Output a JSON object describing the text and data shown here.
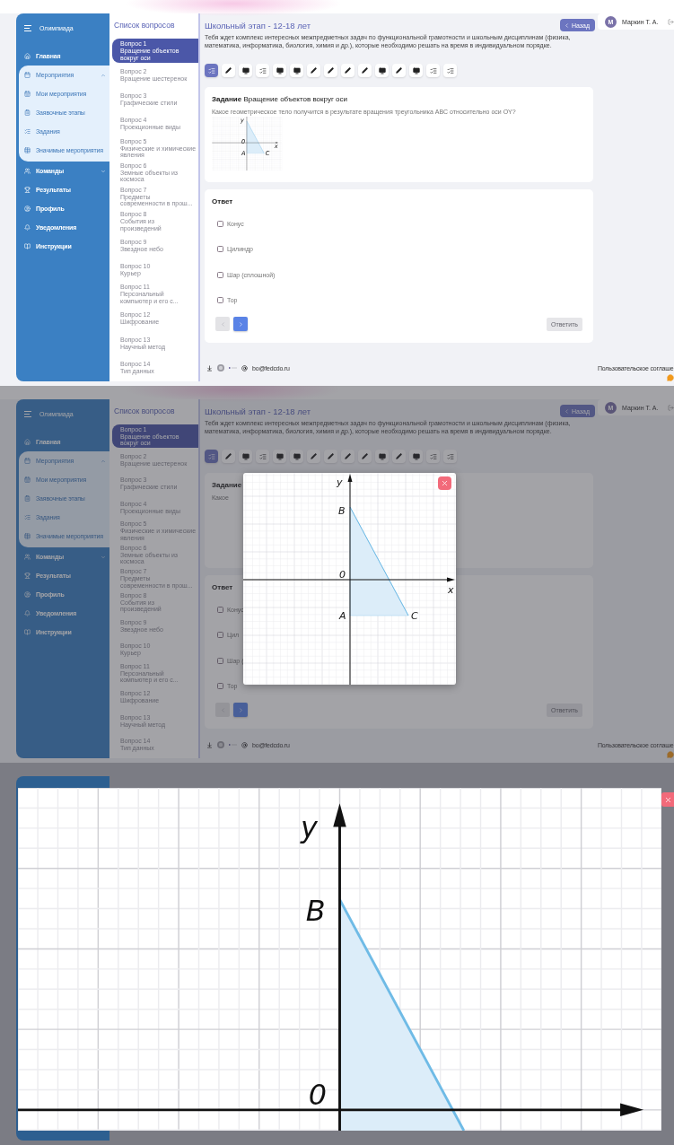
{
  "screens": [
    {
      "kind": "plain",
      "app": {
        "brand": "Олимпиада",
        "nav": [
          {
            "label": "Главная"
          },
          {
            "label": "Мероприятия",
            "expanded": true,
            "children": [
              {
                "label": "Мои мероприятия"
              },
              {
                "label": "Заявочные этапы"
              },
              {
                "label": "Задания"
              },
              {
                "label": "Значимые мероприятия"
              }
            ]
          },
          {
            "label": "Команды",
            "expanded": false
          },
          {
            "label": "Результаты"
          },
          {
            "label": "Профиль"
          },
          {
            "label": "Уведомления"
          },
          {
            "label": "Инструкции"
          }
        ],
        "questions_title": "Список вопросов",
        "questions": [
          {
            "title": "Вопрос 1",
            "subtitle": "Вращение объектов вокруг оси",
            "selected": true
          },
          {
            "title": "Вопрос 2",
            "subtitle": "Вращение шестеренок",
            "selected": false
          },
          {
            "title": "Вопрос 3",
            "subtitle": "Графические стили",
            "selected": false
          },
          {
            "title": "Вопрос 4",
            "subtitle": "Проекционные виды",
            "selected": false
          },
          {
            "title": "Вопрос 5",
            "subtitle": "Физические и химические явления",
            "selected": false
          },
          {
            "title": "Вопрос 6",
            "subtitle": "Земные объекты из космоса",
            "selected": false
          },
          {
            "title": "Вопрос 7",
            "subtitle": "Предметы современности в прош...",
            "selected": false
          },
          {
            "title": "Вопрос 8",
            "subtitle": "События из произведений",
            "selected": false
          },
          {
            "title": "Вопрос 9",
            "subtitle": "Звездное небо",
            "selected": false
          },
          {
            "title": "Вопрос 10",
            "subtitle": "Курьер",
            "selected": false
          },
          {
            "title": "Вопрос 11",
            "subtitle": "Персональный компьютер и его с...",
            "selected": false
          },
          {
            "title": "Вопрос 12",
            "subtitle": "Шифрование",
            "selected": false
          },
          {
            "title": "Вопрос 13",
            "subtitle": "Научный метод",
            "selected": false
          },
          {
            "title": "Вопрос 14",
            "subtitle": "Тип данных",
            "selected": false
          }
        ],
        "stage_title": "Школьный этап - 12-18 лет",
        "description": "Тебя ждет комплекс интересных межпредметных задач по функциональной грамотности и школьным дисциплинам (физика, математика, информатика, биология, химия и др.), которые необходимо решать на время в индивидуальном порядке.",
        "back_button": "Назад",
        "user": {
          "initial": "М",
          "name": "Маркин Т. А."
        },
        "tools": [
          {
            "kind": "list",
            "selected": true
          },
          {
            "kind": "pen",
            "selected": false
          },
          {
            "kind": "monitor",
            "selected": false
          },
          {
            "kind": "list",
            "selected": false
          },
          {
            "kind": "monitor",
            "selected": false
          },
          {
            "kind": "monitor",
            "selected": false
          },
          {
            "kind": "pen",
            "selected": false
          },
          {
            "kind": "pen",
            "selected": false
          },
          {
            "kind": "pen",
            "selected": false
          },
          {
            "kind": "pen",
            "selected": false
          },
          {
            "kind": "monitor",
            "selected": false
          },
          {
            "kind": "pen",
            "selected": false
          },
          {
            "kind": "monitor",
            "selected": false
          },
          {
            "kind": "list",
            "selected": false
          },
          {
            "kind": "list",
            "selected": false
          }
        ],
        "task": {
          "heading": "Задание",
          "title": "Вращение объектов вокруг оси",
          "question": "Какое геометрическое тело получится в результате вращения треугольника ABC относительно оси OY?",
          "figure": {
            "labels": [
              {
                "kind": "y-axis",
                "text": "y"
              },
              {
                "kind": "origin",
                "text": "0"
              },
              {
                "kind": "x-axis",
                "text": "x"
              },
              {
                "kind": "vertex-a",
                "text": "A"
              },
              {
                "kind": "vertex-c",
                "text": "C"
              }
            ]
          }
        },
        "answer": {
          "heading": "Ответ",
          "options": [
            {
              "label": "Конус",
              "checked": false
            },
            {
              "label": "Цилиндр",
              "checked": false
            },
            {
              "label": "Шар (сплошной)",
              "checked": false
            },
            {
              "label": "Тор",
              "checked": false
            }
          ],
          "prev": {
            "disabled": true
          },
          "next": {
            "disabled": false
          },
          "submit": {
            "label": "Ответить",
            "disabled": true
          }
        },
        "footer": {
          "email": "bo@fedcdo.ru",
          "agreement": "Пользовательское соглаше"
        }
      }
    },
    {
      "kind": "modal",
      "app": {
        "brand": "Олимпиада",
        "nav": [
          {
            "label": "Главная"
          },
          {
            "label": "Мероприятия",
            "expanded": true,
            "children": [
              {
                "label": "Мои мероприятия"
              },
              {
                "label": "Заявочные этапы"
              },
              {
                "label": "Задания"
              },
              {
                "label": "Значимые мероприятия"
              }
            ]
          },
          {
            "label": "Команды",
            "expanded": false
          },
          {
            "label": "Результаты"
          },
          {
            "label": "Профиль"
          },
          {
            "label": "Уведомления"
          },
          {
            "label": "Инструкции"
          }
        ],
        "questions_title": "Список вопросов",
        "questions": [
          {
            "title": "Вопрос 1",
            "subtitle": "Вращение объектов вокруг оси",
            "selected": true
          },
          {
            "title": "Вопрос 2",
            "subtitle": "Вращение шестеренок",
            "selected": false
          },
          {
            "title": "Вопрос 3",
            "subtitle": "Графические стили",
            "selected": false
          },
          {
            "title": "Вопрос 4",
            "subtitle": "Проекционные виды",
            "selected": false
          },
          {
            "title": "Вопрос 5",
            "subtitle": "Физические и химические явления",
            "selected": false
          },
          {
            "title": "Вопрос 6",
            "subtitle": "Земные объекты из космоса",
            "selected": false
          },
          {
            "title": "Вопрос 7",
            "subtitle": "Предметы современности в прош...",
            "selected": false
          },
          {
            "title": "Вопрос 8",
            "subtitle": "События из произведений",
            "selected": false
          },
          {
            "title": "Вопрос 9",
            "subtitle": "Звездное небо",
            "selected": false
          },
          {
            "title": "Вопрос 10",
            "subtitle": "Курьер",
            "selected": false
          },
          {
            "title": "Вопрос 11",
            "subtitle": "Персональный компьютер и его с...",
            "selected": false
          },
          {
            "title": "Вопрос 12",
            "subtitle": "Шифрование",
            "selected": false
          },
          {
            "title": "Вопрос 13",
            "subtitle": "Научный метод",
            "selected": false
          },
          {
            "title": "Вопрос 14",
            "subtitle": "Тип данных",
            "selected": false
          }
        ],
        "stage_title": "Школьный этап - 12-18 лет",
        "description": "Тебя ждет комплекс интересных межпредметных задач по функциональной грамотности и школьным дисциплинам (физика, математика, информатика, биология, химия и др.), которые необходимо решать на время в индивидуальном порядке.",
        "back_button": "Назад",
        "user": {
          "initial": "М",
          "name": "Маркин Т. А."
        },
        "tools": [
          {
            "kind": "list",
            "selected": true
          },
          {
            "kind": "pen",
            "selected": false
          },
          {
            "kind": "monitor",
            "selected": false
          },
          {
            "kind": "list",
            "selected": false
          },
          {
            "kind": "monitor",
            "selected": false
          },
          {
            "kind": "monitor",
            "selected": false
          },
          {
            "kind": "pen",
            "selected": false
          },
          {
            "kind": "pen",
            "selected": false
          },
          {
            "kind": "pen",
            "selected": false
          },
          {
            "kind": "pen",
            "selected": false
          },
          {
            "kind": "monitor",
            "selected": false
          },
          {
            "kind": "pen",
            "selected": false
          },
          {
            "kind": "monitor",
            "selected": false
          },
          {
            "kind": "list",
            "selected": false
          },
          {
            "kind": "list",
            "selected": false
          }
        ],
        "task": {
          "heading": "Задание",
          "question": "Какое"
        },
        "answer": {
          "heading": "Ответ",
          "options": [
            {
              "label": "Конус",
              "checked": false
            },
            {
              "label": "Цил",
              "checked": false
            },
            {
              "label": "Шар (",
              "checked": false
            },
            {
              "label": "Тор",
              "checked": false
            }
          ],
          "prev": {
            "disabled": true
          },
          "next": {
            "disabled": false
          },
          "submit": {
            "label": "Ответить",
            "disabled": true
          }
        },
        "footer": {
          "email": "bo@fedcdo.ru",
          "agreement": "Пользовательское соглаше"
        }
      },
      "figure": {
        "labels": [
          {
            "kind": "y-axis",
            "text": "y"
          },
          {
            "kind": "vertex-b",
            "text": "B"
          },
          {
            "kind": "origin",
            "text": "0"
          },
          {
            "kind": "x-axis",
            "text": "x"
          },
          {
            "kind": "vertex-a",
            "text": "A"
          },
          {
            "kind": "vertex-c",
            "text": "C"
          }
        ]
      }
    },
    {
      "kind": "zoomed",
      "figure": {
        "labels": [
          {
            "kind": "y-axis",
            "text": "y"
          },
          {
            "kind": "vertex-b",
            "text": "B"
          },
          {
            "kind": "origin",
            "text": "0"
          }
        ]
      }
    }
  ]
}
